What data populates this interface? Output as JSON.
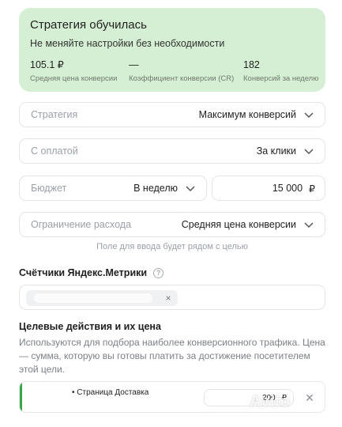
{
  "status": {
    "title": "Стратегия обучилась",
    "subtitle": "Не меняйте настройки без необходимости",
    "metrics": [
      {
        "value": "105.1 ₽",
        "label": "Средняя цена конверсии"
      },
      {
        "value": "—",
        "label": "Коэффициент конверсии (CR)"
      },
      {
        "value": "182",
        "label": "Конверсий за неделю"
      }
    ]
  },
  "fields": {
    "strategy": {
      "label": "Стратегия",
      "value": "Максимум конверсий"
    },
    "payment": {
      "label": "С оплатой",
      "value": "За клики"
    },
    "budget": {
      "label": "Бюджет",
      "period": "В неделю",
      "amount": "15 000",
      "currency": "₽"
    },
    "limit": {
      "label": "Ограничение расхода",
      "value": "Средняя цена конверсии"
    }
  },
  "hint": "Поле для ввода будет рядом с целью",
  "counters": {
    "title": "Счётчики Яндекс.Метрики",
    "help_icon": "question-icon",
    "chip_remove": "×"
  },
  "goals": {
    "title": "Целевые действия и их цена",
    "description": "Используются для подбора наиболее конверсионного трафика. Цена — сумма, которую вы готовы платить за достижение посетителем этой цели.",
    "items": [
      {
        "name": "• Страница Доставка",
        "price": "200",
        "currency": "₽",
        "remove": "✕"
      }
    ]
  },
  "watermark": "Avito",
  "colors": {
    "status_bg": "#d4efd3",
    "accent_green": "#3aa64a",
    "border": "#e2e4e8",
    "muted_text": "#9aa0a8"
  }
}
